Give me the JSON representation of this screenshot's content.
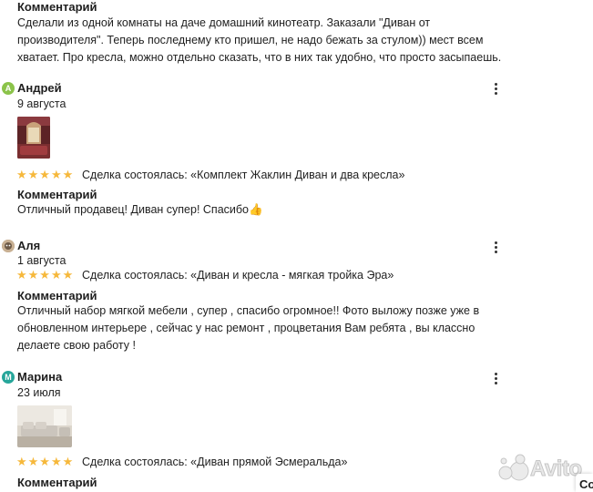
{
  "review0": {
    "comment_heading": "Комментарий",
    "comment_lines": [
      "Сделали из одной комнаты на даче домашний кинотеатр. Заказали \"Диван от",
      "производителя\". Теперь последнему кто пришел, не надо бежать за стулом)) мест всем",
      "хватает. Про кресла, можно отдельно сказать, что в них так удобно, что просто засыпаешь."
    ]
  },
  "review1": {
    "avatar_letter": "А",
    "avatar_color": "#8bc34a",
    "name": "Андрей",
    "date": "9 августа",
    "rating": 5,
    "stars": "★★★★★",
    "deal": "Сделка состоялась: «Комплект Жаклин Диван и два кресла»",
    "comment_heading": "Комментарий",
    "comment": "Отличный продавец! Диван супер! Спасибо👍"
  },
  "review2": {
    "name": "Аля",
    "date": "1 августа",
    "rating": 5,
    "stars": "★★★★★",
    "deal": "Сделка состоялась: «Диван и кресла - мягкая тройка Эра»",
    "comment_heading": "Комментарий",
    "comment_lines": [
      "Отличный набор мягкой мебели , супер , спасибо огромное!! Фото выложу позже уже в",
      "обновленном интерьере , сейчас у нас ремонт , процветания Вам ребята , вы классно",
      "делаете свою работу !"
    ]
  },
  "review3": {
    "avatar_letter": "М",
    "avatar_color": "#26a69a",
    "name": "Марина",
    "date": "23 июля",
    "rating": 5,
    "stars": "★★★★★",
    "deal": "Сделка состоялась: «Диван прямой Эсмеральда»",
    "comment_heading": "Комментарий"
  },
  "watermark": "Avito",
  "corner_text": "Co",
  "colors": {
    "star": "#f6b83b",
    "text": "#1f1f1f"
  },
  "icons": {
    "menu": "kebab-menu-icon",
    "star": "star-icon"
  }
}
